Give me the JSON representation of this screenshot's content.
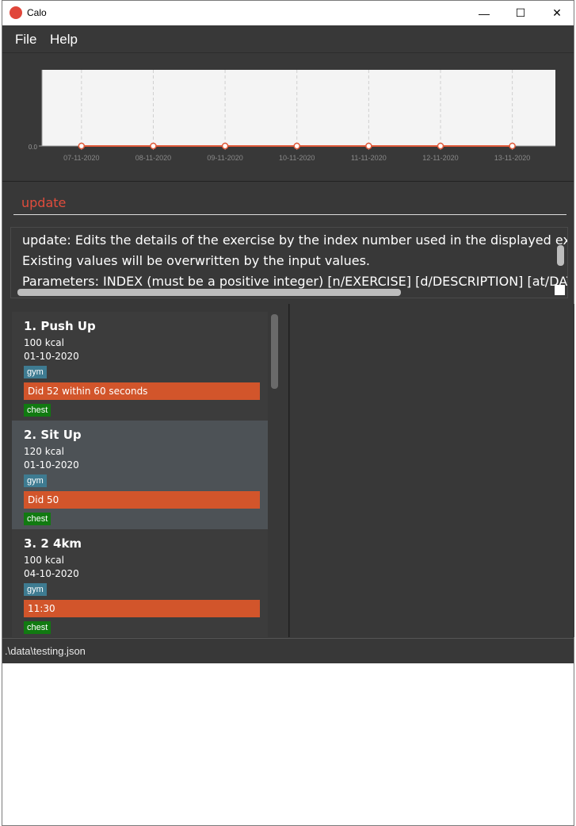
{
  "window": {
    "title": "Calo",
    "minimize": "—",
    "maximize": "☐",
    "close": "✕"
  },
  "menu": {
    "file": "File",
    "help": "Help"
  },
  "chart_data": {
    "type": "line",
    "x": [
      "07-11-2020",
      "08-11-2020",
      "09-11-2020",
      "10-11-2020",
      "11-11-2020",
      "12-11-2020",
      "13-11-2020"
    ],
    "values": [
      0,
      0,
      0,
      0,
      0,
      0,
      0
    ],
    "y_tick_labels": [
      "0.0"
    ],
    "grid": true,
    "line_color": "#e05a3a"
  },
  "command": {
    "value": "update"
  },
  "result": {
    "lines": [
      "update: Edits the details of the exercise by the index number used in the displayed exercise list.",
      "Existing values will be overwritten by the input values.",
      "Parameters: INDEX (must be a positive integer) [n/EXERCISE] [d/DESCRIPTION] [at/DATE] [c/CALORIES]"
    ]
  },
  "exercises": [
    {
      "title": "1.  Push Up",
      "calories": "100  kcal",
      "date": "01-10-2020",
      "tag1": "gym",
      "description": "Did 52 within 60 seconds",
      "tag2": "chest"
    },
    {
      "title": "2.  Sit Up",
      "calories": "120  kcal",
      "date": "01-10-2020",
      "tag1": "gym",
      "description": "Did 50",
      "tag2": "chest"
    },
    {
      "title": "3.  2 4km",
      "calories": "100  kcal",
      "date": "04-10-2020",
      "tag1": "gym",
      "description": "11:30",
      "tag2": "chest"
    }
  ],
  "status": {
    "path": ".\\data\\testing.json"
  },
  "colors": {
    "accent": "#d2552b",
    "gym_tag": "#3e7b91",
    "chest_tag": "#117a11",
    "background": "#383838"
  }
}
